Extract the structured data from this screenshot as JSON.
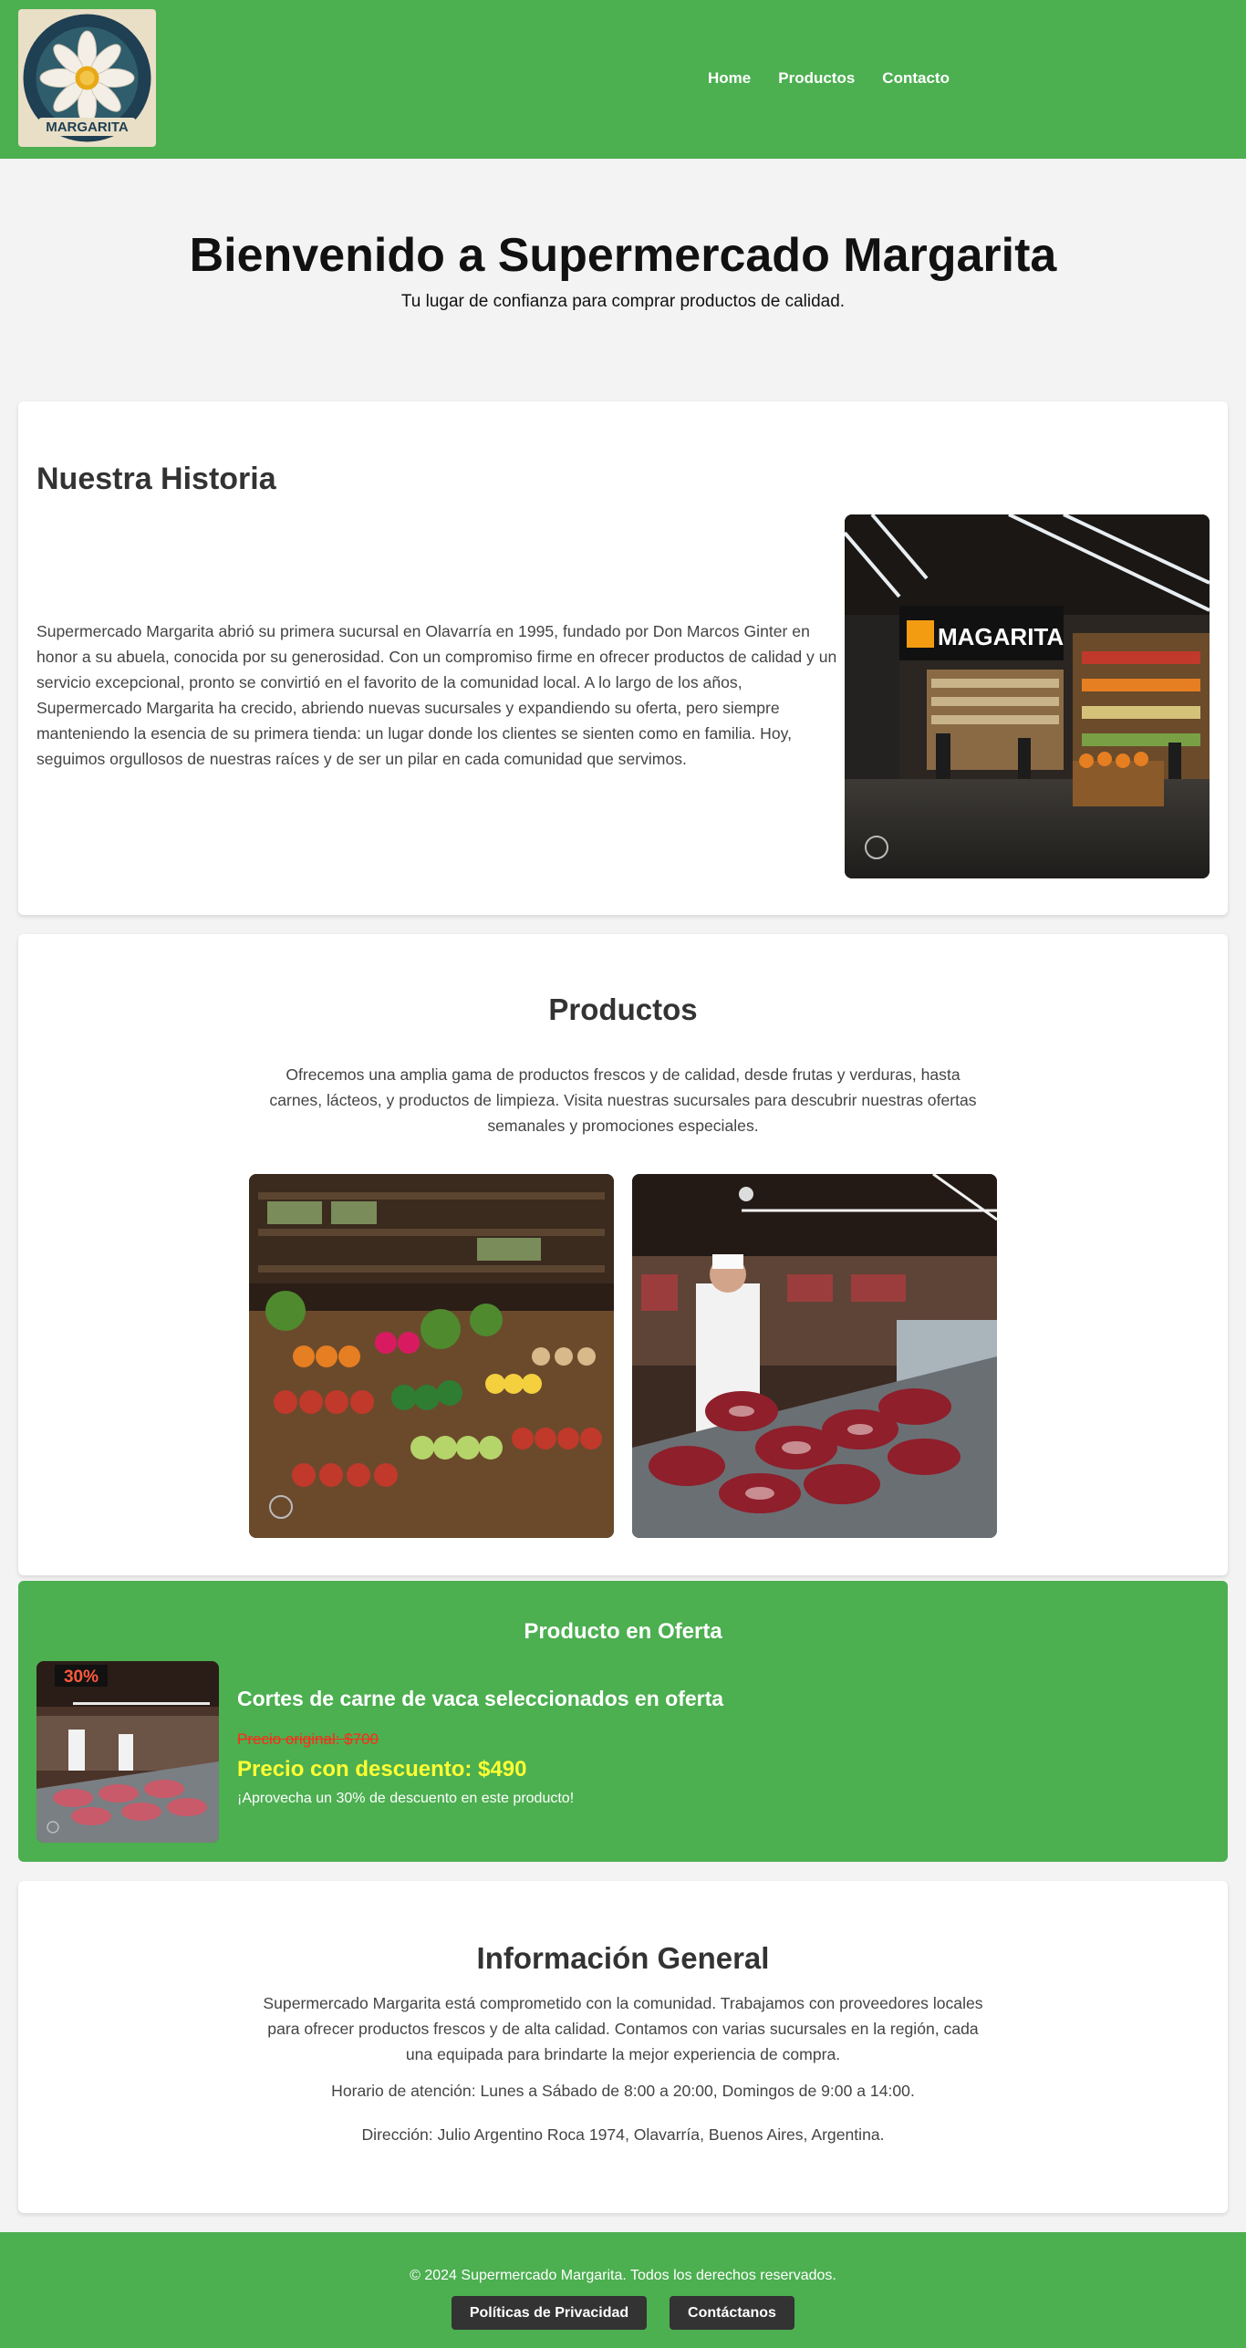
{
  "header": {
    "logo_text": "MARGARITA",
    "nav": [
      "Home",
      "Productos",
      "Contacto"
    ]
  },
  "hero": {
    "title": "Bienvenido a Supermercado Margarita",
    "subtitle": "Tu lugar de confianza para comprar productos de calidad."
  },
  "historia": {
    "title": "Nuestra Historia",
    "text": "Supermercado Margarita abrió su primera sucursal en Olavarría en 1995, fundado por Don Marcos Ginter en honor a su abuela, conocida por su generosidad. Con un compromiso firme en ofrecer productos de calidad y un servicio excepcional, pronto se convirtió en el favorito de la comunidad local. A lo largo de los años, Supermercado Margarita ha crecido, abriendo nuevas sucursales y expandiendo su oferta, pero siempre manteniendo la esencia de su primera tienda: un lugar donde los clientes se sienten como en familia. Hoy, seguimos orgullosos de nuestras raíces y de ser un pilar en cada comunidad que servimos.",
    "store_sign": "MAGARITA"
  },
  "productos": {
    "title": "Productos",
    "text": "Ofrecemos una amplia gama de productos frescos y de calidad, desde frutas y verduras, hasta carnes, lácteos, y productos de limpieza. Visita nuestras sucursales para descubrir nuestras ofertas semanales y promociones especiales."
  },
  "oferta": {
    "title": "Producto en Oferta",
    "badge": "30%",
    "product": "Cortes de carne de vaca seleccionados en oferta",
    "original_price": "Precio original: $700",
    "discount_price": "Precio con descuento: $490",
    "note": "¡Aprovecha un 30% de descuento en este producto!"
  },
  "info": {
    "title": "Información General",
    "p1": "Supermercado Margarita está comprometido con la comunidad. Trabajamos con proveedores locales para ofrecer productos frescos y de alta calidad. Contamos con varias sucursales en la región, cada una equipada para brindarte la mejor experiencia de compra.",
    "p2": "Horario de atención: Lunes a Sábado de 8:00 a 20:00, Domingos de 9:00 a 14:00.",
    "p3": "Dirección: Julio Argentino Roca 1974, Olavarría, Buenos Aires, Argentina."
  },
  "footer": {
    "copyright": "© 2024 Supermercado Margarita. Todos los derechos reservados.",
    "privacy_button": "Políticas de Privacidad",
    "contact_button": "Contáctanos"
  },
  "colors": {
    "brand_green": "#4caf50",
    "dark_button": "#333333",
    "discount_yellow": "#ffff33",
    "strike_red": "#ff2a1a"
  }
}
